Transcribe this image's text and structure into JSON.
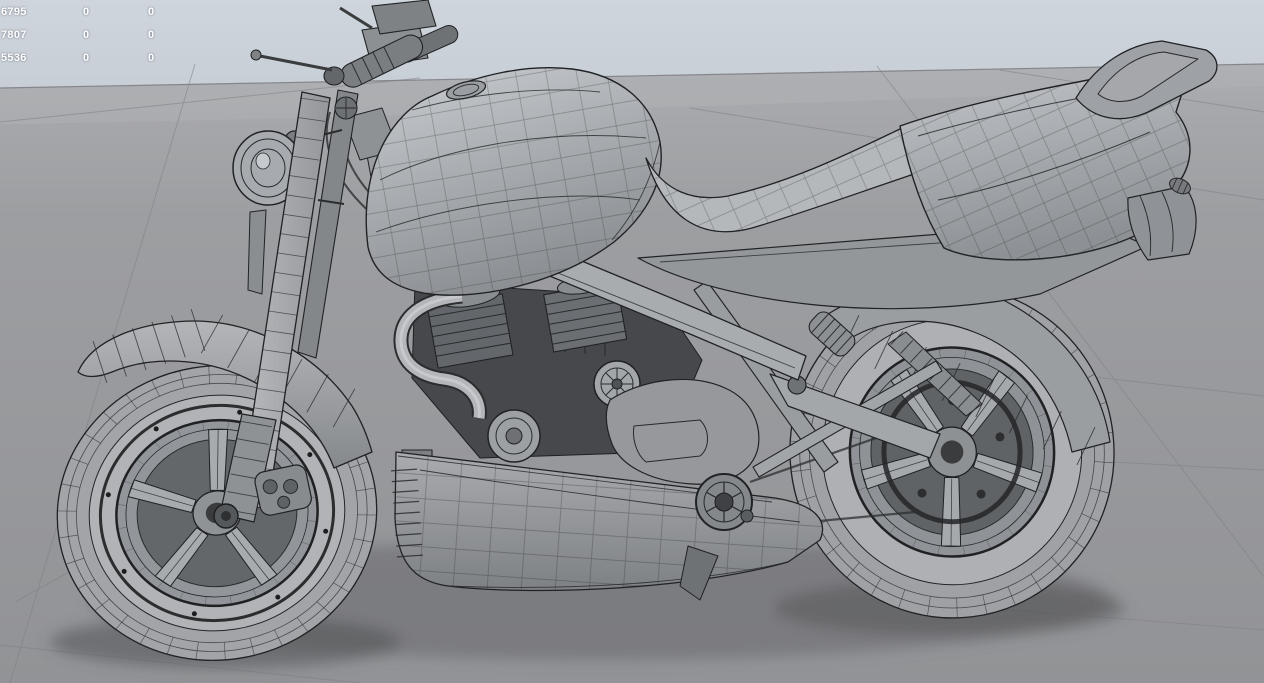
{
  "viewport": {
    "kind": "3d-wireframe-viewport",
    "subject": "motorcycle-model-side-view"
  },
  "stats": {
    "rows": [
      {
        "c1": "6795",
        "c2": "0",
        "c3": "0"
      },
      {
        "c1": "7807",
        "c2": "0",
        "c3": "0"
      },
      {
        "c1": "5536",
        "c2": "0",
        "c3": "0"
      }
    ]
  },
  "colors": {
    "sky": "#cdd4dc",
    "ground": "#9b9c9f",
    "grid_line": "#808186",
    "wire_line": "#232527",
    "surface_mid": "#9b9ea2",
    "surface_light": "#c6c9cd",
    "surface_dark": "#46484b",
    "stats_text": "#ffffff"
  }
}
